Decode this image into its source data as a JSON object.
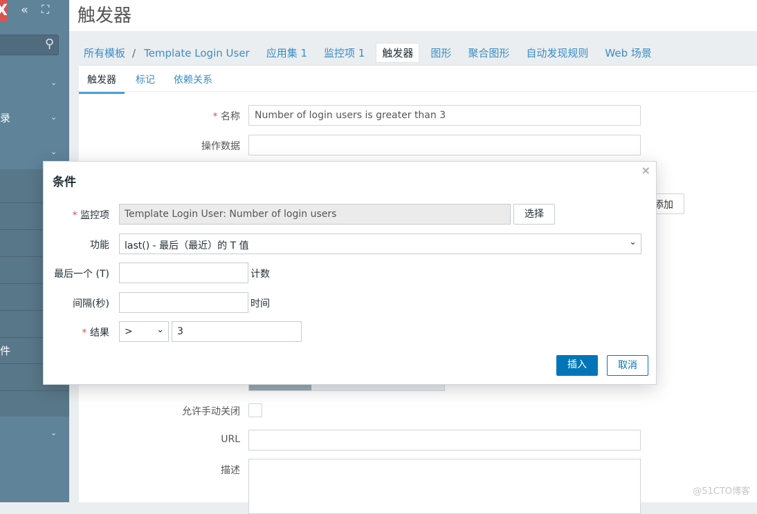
{
  "sidebar": {
    "logo": "X",
    "search_icon": "search-icon",
    "items": [
      {
        "label": ""
      },
      {
        "label": "录"
      },
      {
        "label": ""
      },
      {
        "label": "件"
      }
    ]
  },
  "header": {
    "title": "触发器"
  },
  "breadcrumb": {
    "all_templates": "所有模板",
    "separator": "/",
    "template": "Template Login User",
    "tabs": [
      "应用集 1",
      "监控项 1",
      "触发器",
      "图形",
      "聚合图形",
      "自动发现规则",
      "Web 场景"
    ]
  },
  "tabs": [
    "触发器",
    "标记",
    "依赖关系"
  ],
  "form": {
    "name_label": "名称",
    "name_value": "Number of login users is greater than 3",
    "opdata_label": "操作数据",
    "opdata_value": "",
    "add_button": "添加",
    "manual_close_label": "允许手动关闭",
    "url_label": "URL",
    "url_value": "",
    "desc_label": "描述",
    "desc_value": ""
  },
  "dialog": {
    "title": "条件",
    "item_label": "监控项",
    "item_value": "Template Login User: Number of login users",
    "select_button": "选择",
    "function_label": "功能",
    "function_value": "last() - 最后（最近）的 T 值",
    "last_label": "最后一个 (T)",
    "last_value": "",
    "last_suffix": "计数",
    "interval_label": "间隔(秒)",
    "interval_value": "",
    "interval_suffix": "时间",
    "result_label": "结果",
    "result_operator": ">",
    "result_value": "3",
    "insert_button": "插入",
    "cancel_button": "取消"
  },
  "watermark": "@51CTO博客",
  "colors": {
    "sidebar": "#5f8399",
    "accent": "#0275b8",
    "link": "#3a8cc6",
    "required": "#d9534f"
  }
}
